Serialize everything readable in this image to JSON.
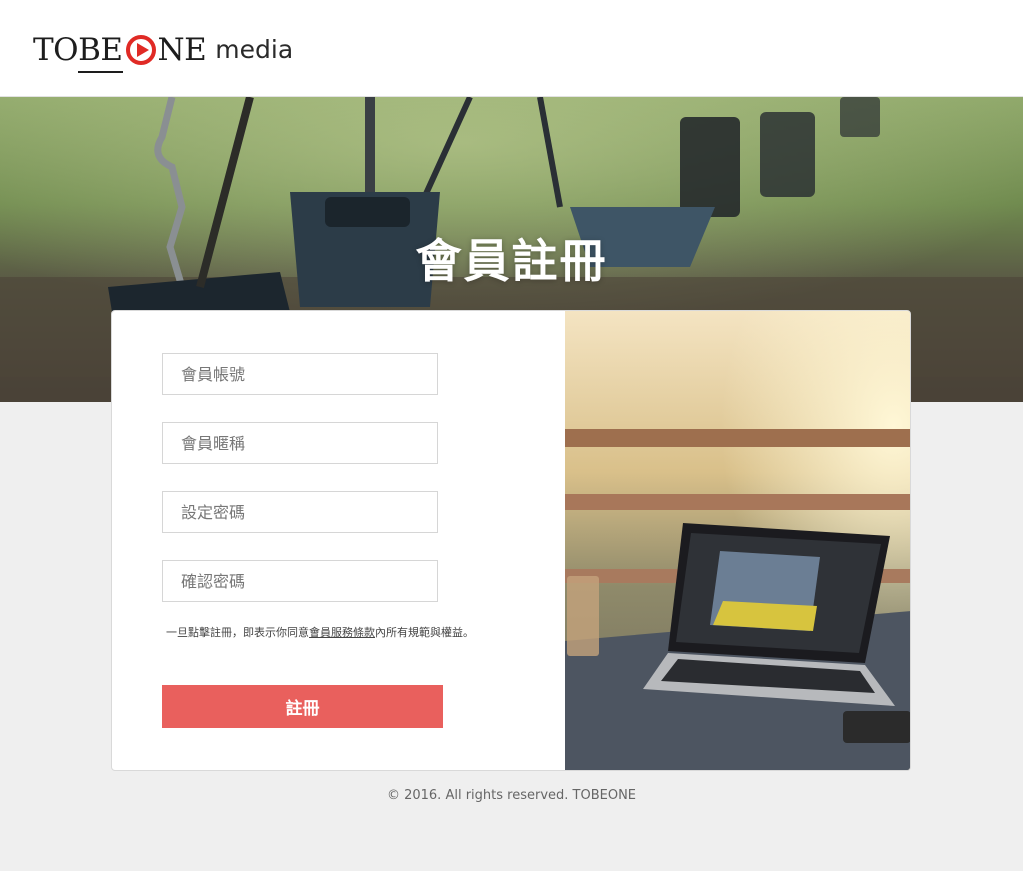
{
  "brand": {
    "logo_part1": "TO",
    "logo_part2": "BE",
    "logo_part3": "NE",
    "logo_media": "media",
    "accent_color": "#e02a25"
  },
  "hero": {
    "title": "會員註冊"
  },
  "form": {
    "account_placeholder": "會員帳號",
    "nickname_placeholder": "會員暱稱",
    "password_placeholder": "設定密碼",
    "confirm_placeholder": "確認密碼",
    "terms_prefix": "一旦點擊註冊，即表示你同意",
    "terms_link": "會員服務條款",
    "terms_suffix": "內所有規範與權益。",
    "submit_label": "註冊",
    "submit_color": "#e9605d"
  },
  "footer": {
    "copyright": "© 2016. All rights reserved. TOBEONE"
  }
}
